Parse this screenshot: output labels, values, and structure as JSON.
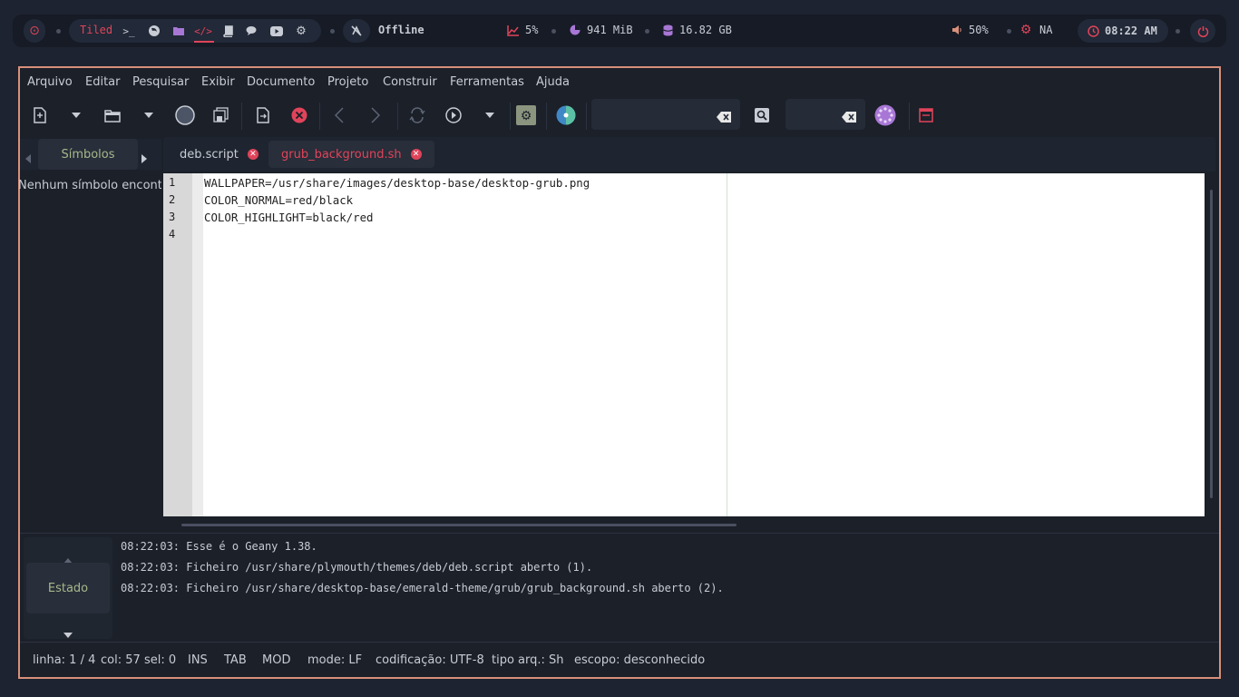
{
  "topbar": {
    "layout_label": "Tiled",
    "network_status": "Offline",
    "cpu": "5%",
    "memory": "941 MiB",
    "disk": "16.82 GB",
    "volume": "50%",
    "temp": "NA",
    "clock": "08:22 AM",
    "icons": [
      "debian-logo-icon",
      "terminal-icon",
      "firefox-icon",
      "folder-icon",
      "code-icon",
      "book-icon",
      "chat-icon",
      "youtube-icon",
      "settings-icon",
      "network-off-icon",
      "cpu-chart-icon",
      "memory-pie-icon",
      "disk-icon",
      "volume-icon",
      "temp-gear-icon",
      "clock-icon",
      "power-icon"
    ],
    "colors": {
      "accent": "#e0445a",
      "purple": "#a877d6",
      "pill": "#222938"
    }
  },
  "menu": {
    "items": [
      "Arquivo",
      "Editar",
      "Pesquisar",
      "Exibir",
      "Documento",
      "Projeto",
      "Construir",
      "Ferramentas",
      "Ajuda"
    ]
  },
  "toolbar": {
    "icons": [
      "new-file-icon",
      "dropdown-icon",
      "open-folder-icon",
      "dropdown-icon",
      "color-circle-icon",
      "save-all-icon",
      "revert-icon",
      "close-file-icon",
      "back-icon",
      "forward-icon",
      "reload-icon",
      "run-icon",
      "dropdown-icon",
      "build-settings-icon",
      "color-chooser-icon",
      "search-icon",
      "clear-icon",
      "quit-icon"
    ],
    "search_value": "",
    "goto_value": ""
  },
  "sidebar": {
    "tab_label": "Símbolos",
    "message": "Nenhum símbolo encontrado"
  },
  "tabs": [
    {
      "label": "deb.script",
      "active": false
    },
    {
      "label": "grub_background.sh",
      "active": true
    }
  ],
  "editor": {
    "line_numbers": [
      "1",
      "2",
      "3",
      "4"
    ],
    "lines": [
      "WALLPAPER=/usr/share/images/desktop-base/desktop-grub.png",
      "COLOR_NORMAL=red/black",
      "COLOR_HIGHLIGHT=black/red",
      ""
    ]
  },
  "messages": {
    "tab_label": "Estado",
    "lines": [
      "08:22:03: Esse é o Geany 1.38.",
      "08:22:03: Ficheiro /usr/share/plymouth/themes/deb/deb.script aberto (1).",
      "08:22:03: Ficheiro /usr/share/desktop-base/emerald-theme/grub/grub_background.sh aberto (2)."
    ]
  },
  "status": {
    "line": "linha: 1 / 4",
    "col": "col: 57",
    "sel": "sel: 0",
    "ins": "INS",
    "tab": "TAB",
    "mod": "MOD",
    "mode": "mode: LF",
    "encoding": "codificação: UTF-8",
    "filetype": "tipo arq.: Sh",
    "scope": "escopo: desconhecido"
  }
}
